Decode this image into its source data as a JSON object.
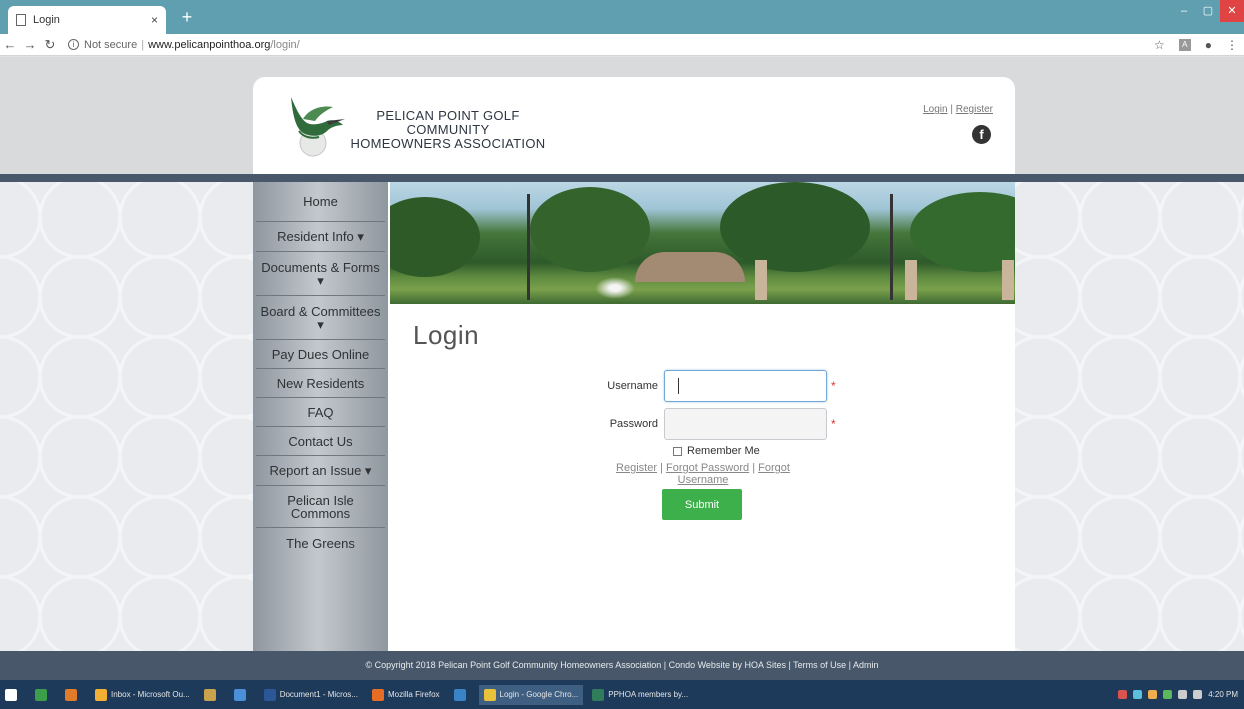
{
  "browser": {
    "tab_title": "Login",
    "tab_close": "×",
    "new_tab": "+",
    "not_secure": "Not secure",
    "url_domain": "www.pelicanpointhoa.org",
    "url_path": "/login/",
    "win_minimize": "–",
    "win_maximize": "▢",
    "win_close": "✕"
  },
  "header": {
    "org_line1": "PELICAN POINT GOLF COMMUNITY",
    "org_line2": "HOMEOWNERS ASSOCIATION",
    "login_link": "Login",
    "link_sep": "|",
    "register_link": "Register",
    "facebook_glyph": "f"
  },
  "sidebar": {
    "items": [
      {
        "label": "Home"
      },
      {
        "label": "Resident Info ▾"
      },
      {
        "label": "Documents & Forms ▾"
      },
      {
        "label": "Board & Committees ▾"
      },
      {
        "label": "Pay Dues Online"
      },
      {
        "label": "New Residents"
      },
      {
        "label": "FAQ"
      },
      {
        "label": "Contact Us"
      },
      {
        "label": "Report an Issue ▾"
      },
      {
        "label": "Pelican Isle Commons"
      },
      {
        "label": "The Greens"
      }
    ]
  },
  "login": {
    "title": "Login",
    "username_label": "Username",
    "password_label": "Password",
    "required_mark": "*",
    "remember_label": "Remember Me",
    "register_link": "Register",
    "forgot_password_link": "Forgot Password",
    "forgot_username_link": "Forgot Username",
    "link_sep": "|",
    "submit_label": "Submit"
  },
  "footer": {
    "text": "© Copyright 2018 Pelican Point Golf Community Homeowners Association | Condo Website by HOA Sites | Terms of Use | Admin"
  },
  "taskbar": {
    "items": [
      {
        "label": "Inbox - Microsoft Ou..."
      },
      {
        "label": "Document1 - Micros..."
      },
      {
        "label": "Mozilla Firefox"
      },
      {
        "label": "Login - Google Chro..."
      },
      {
        "label": "PPHOA members by..."
      }
    ],
    "clock": "4:20 PM"
  },
  "colors": {
    "tabbar": "#5f9fb0",
    "band": "#48586a",
    "submit": "#3daf4b",
    "taskbar": "#1d3a5a"
  }
}
